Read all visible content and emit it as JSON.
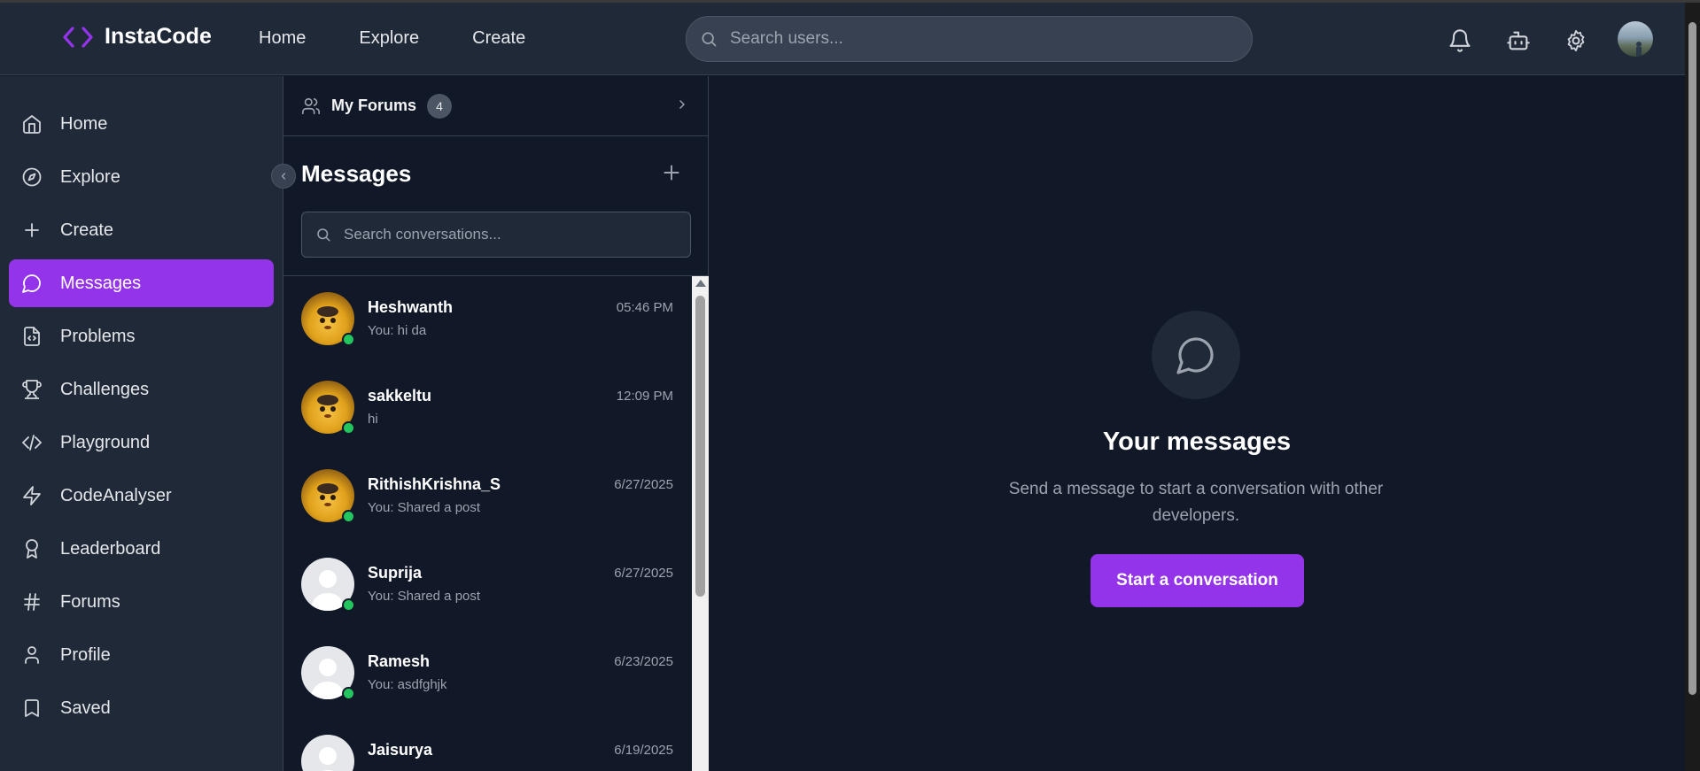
{
  "header": {
    "logo_text": "InstaCode",
    "nav": [
      "Home",
      "Explore",
      "Create"
    ],
    "search_placeholder": "Search users...",
    "icons": [
      "bell-icon",
      "bot-icon",
      "gear-icon"
    ]
  },
  "sidebar": {
    "items": [
      {
        "label": "Home",
        "icon": "home-icon"
      },
      {
        "label": "Explore",
        "icon": "compass-icon"
      },
      {
        "label": "Create",
        "icon": "plus-icon"
      },
      {
        "label": "Messages",
        "icon": "message-icon",
        "active": true
      },
      {
        "label": "Problems",
        "icon": "file-code-icon"
      },
      {
        "label": "Challenges",
        "icon": "trophy-icon"
      },
      {
        "label": "Playground",
        "icon": "code-icon"
      },
      {
        "label": "CodeAnalyser",
        "icon": "zap-icon"
      },
      {
        "label": "Leaderboard",
        "icon": "award-icon"
      },
      {
        "label": "Forums",
        "icon": "hash-icon"
      },
      {
        "label": "Profile",
        "icon": "user-icon"
      },
      {
        "label": "Saved",
        "icon": "bookmark-icon"
      }
    ]
  },
  "messages_panel": {
    "forums_label": "My Forums",
    "forums_count": "4",
    "title": "Messages",
    "search_placeholder": "Search conversations...",
    "conversations": [
      {
        "name": "Heshwanth",
        "time": "05:46 PM",
        "preview": "You: hi da",
        "avatar": "pikachu",
        "online": true
      },
      {
        "name": "sakkeltu",
        "time": "12:09 PM",
        "preview": "hi",
        "avatar": "pikachu",
        "online": true
      },
      {
        "name": "RithishKrishna_S",
        "time": "6/27/2025",
        "preview": "You: Shared a post",
        "avatar": "pikachu",
        "online": true
      },
      {
        "name": "Suprija",
        "time": "6/27/2025",
        "preview": "You: Shared a post",
        "avatar": "default",
        "online": true
      },
      {
        "name": "Ramesh",
        "time": "6/23/2025",
        "preview": "You: asdfghjk",
        "avatar": "default",
        "online": true
      },
      {
        "name": "Jaisurya",
        "time": "6/19/2025",
        "preview": "",
        "avatar": "default",
        "online": false
      }
    ]
  },
  "main": {
    "title": "Your messages",
    "subtitle": "Send a message to start a conversation with other developers.",
    "button": "Start a conversation"
  },
  "colors": {
    "accent": "#9333ea",
    "bg": "#111827",
    "panel": "#1f2937",
    "online": "#22c55e"
  }
}
